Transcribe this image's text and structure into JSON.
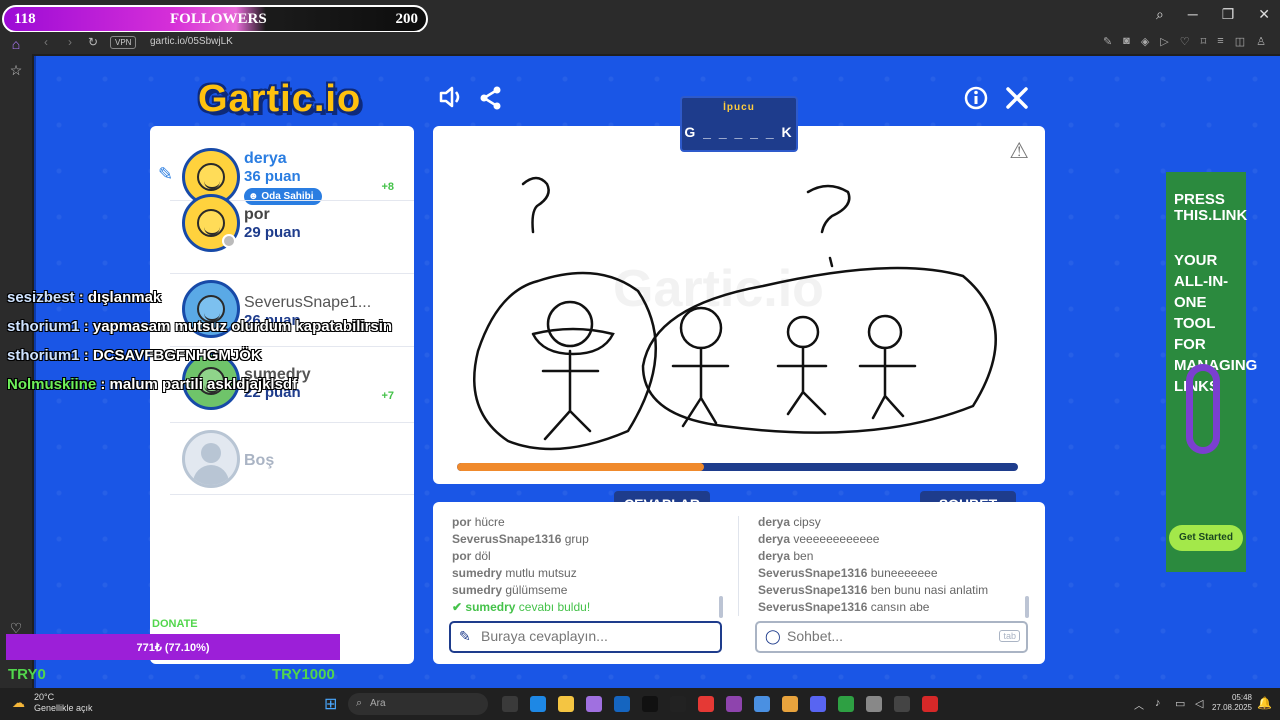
{
  "stream_overlay": {
    "followers_current": "118",
    "followers_label": "FOLLOWERS",
    "followers_goal": "200",
    "chat": [
      {
        "user": "sesizbest",
        "text": ": dışlanmak"
      },
      {
        "user": "sthorium1",
        "text": ": yapmasam mutsuz olurdum kapatabilirsin"
      },
      {
        "user": "sthorium1",
        "text": ": DCSAVFBGFNHGMJÖK"
      },
      {
        "user": "Nolmuskiine",
        "text": ": malum partili askldjajklsdf"
      }
    ],
    "donate_label": "DONATE",
    "donate_progress": "771₺ (77.10%)",
    "donate_min": "TRY0",
    "donate_max": "TRY1000"
  },
  "browser": {
    "vpn_label": "VPN",
    "url": "gartic.io/05SbwjLK"
  },
  "game": {
    "logo": "Gartic.io",
    "hint_title": "İpucu",
    "hint_word": "G _ _ _ _ _ K",
    "round_progress": 0.44,
    "players": [
      {
        "name": "derya",
        "points": "36 puan",
        "bonus": "+8",
        "badge": "Oda Sahibi"
      },
      {
        "name": "por",
        "points": "29 puan",
        "bonus": ""
      },
      {
        "name": "SeverusSnape1...",
        "points": "26 puan",
        "bonus": ""
      },
      {
        "name": "sumedry",
        "points": "22 puan",
        "bonus": "+7"
      },
      {
        "name": "Boş",
        "points": "",
        "bonus": ""
      }
    ],
    "answers_tab": "CEVAPLAR",
    "chat_tab": "SOHBET",
    "answers": [
      {
        "user": "por",
        "text": "hücre"
      },
      {
        "user": "SeverusSnape1316",
        "text": "grup"
      },
      {
        "user": "por",
        "text": "döl"
      },
      {
        "user": "sumedry",
        "text": "mutlu mutsuz"
      },
      {
        "user": "sumedry",
        "text": "gülümseme"
      },
      {
        "user": "sumedry",
        "text": "cevabı buldu!"
      }
    ],
    "chat": [
      {
        "user": "derya",
        "text": "cipsy"
      },
      {
        "user": "derya",
        "text": "veeeeeeeeeeee"
      },
      {
        "user": "derya",
        "text": "ben"
      },
      {
        "user": "SeverusSnape1316",
        "text": "buneeeeeee"
      },
      {
        "user": "SeverusSnape1316",
        "text": "ben bunu nasi anlatim"
      },
      {
        "user": "SeverusSnape1316",
        "text": "cansın abe"
      }
    ],
    "answer_placeholder": "Buraya cevaplayın...",
    "chat_placeholder": "Sohbet...",
    "chat_key_hint": "tab"
  },
  "ad": {
    "brand_line1": "PRESS",
    "brand_line2": "THIS.LINK",
    "headline": "YOUR ALL-IN-ONE TOOL FOR MANAGING LINKS",
    "cta": "Get Started"
  },
  "taskbar": {
    "temperature": "20°C",
    "weather": "Genellikle açık",
    "search_placeholder": "Ara",
    "time": "05:48",
    "date": "27.08.2025"
  }
}
